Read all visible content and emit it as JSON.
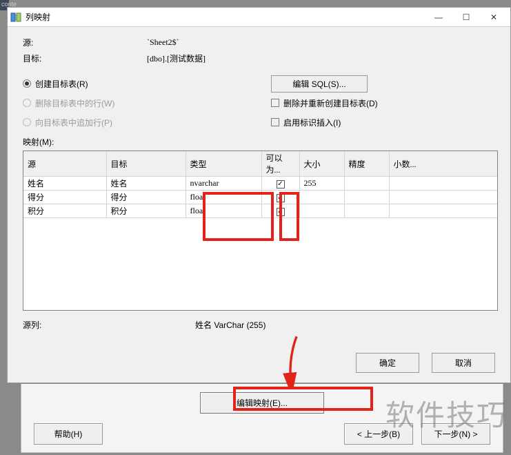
{
  "bg_tag": "conte",
  "dialog": {
    "title": "列映射",
    "source_label": "源:",
    "source_value": "`Sheet2$`",
    "target_label": "目标:",
    "target_value": "[dbo].[测试数据]",
    "radio_create": "创建目标表(R)",
    "radio_delete": "删除目标表中的行(W)",
    "radio_append": "向目标表中追加行(P)",
    "btn_edit_sql": "编辑 SQL(S)...",
    "check_drop_recreate": "删除并重新创建目标表(D)",
    "check_enable_identity": "启用标识插入(I)",
    "mapping_label": "映射(M):",
    "columns": {
      "src": "源",
      "tgt": "目标",
      "type": "类型",
      "nullable": "可以为...",
      "size": "大小",
      "precision": "精度",
      "scale": "小数..."
    },
    "rows": [
      {
        "src": "姓名",
        "tgt": "姓名",
        "type": "nvarchar",
        "nullable": true,
        "size": "255",
        "precision": "",
        "scale": ""
      },
      {
        "src": "得分",
        "tgt": "得分",
        "type": "float",
        "nullable": true,
        "size": "",
        "precision": "",
        "scale": ""
      },
      {
        "src": "积分",
        "tgt": "积分",
        "type": "float",
        "nullable": true,
        "size": "",
        "precision": "",
        "scale": ""
      }
    ],
    "source_column_label": "源列:",
    "source_column_value": "姓名 VarChar (255)",
    "btn_ok": "确定",
    "btn_cancel": "取消"
  },
  "parent": {
    "btn_edit_mapping": "编辑映射(E)...",
    "btn_help": "帮助(H)",
    "btn_back": "< 上一步(B)",
    "btn_next": "下一步(N) >"
  },
  "watermark": "软件技巧"
}
